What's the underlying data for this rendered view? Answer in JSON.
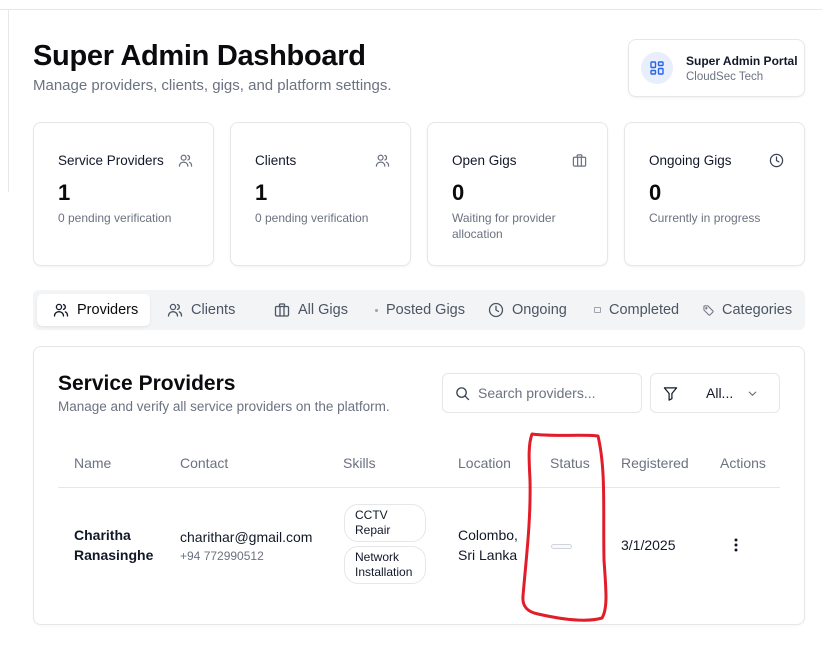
{
  "header": {
    "title": "Super Admin Dashboard",
    "subtitle": "Manage providers, clients, gigs, and platform settings."
  },
  "portal": {
    "title": "Super Admin Portal",
    "company": "CloudSec Tech",
    "icon": "layout-grid-icon"
  },
  "stats": [
    {
      "label": "Service Providers",
      "value": "1",
      "description": "0 pending verification",
      "icon": "users-icon"
    },
    {
      "label": "Clients",
      "value": "1",
      "description": "0 pending verification",
      "icon": "users-icon"
    },
    {
      "label": "Open Gigs",
      "value": "0",
      "description": "Waiting for provider allocation",
      "icon": "briefcase-icon"
    },
    {
      "label": "Ongoing Gigs",
      "value": "0",
      "description": "Currently in progress",
      "icon": "clock-icon"
    }
  ],
  "tabs": [
    {
      "label": "Providers",
      "icon": "users-icon",
      "active": true
    },
    {
      "label": "Clients",
      "icon": "users-icon",
      "active": false
    },
    {
      "label": "All Gigs",
      "icon": "briefcase-icon",
      "active": false
    },
    {
      "label": "Posted Gigs",
      "icon": "dot-icon",
      "active": false
    },
    {
      "label": "Ongoing",
      "icon": "clock-icon",
      "active": false
    },
    {
      "label": "Completed",
      "icon": "box-icon",
      "active": false
    },
    {
      "label": "Categories",
      "icon": "tag-icon",
      "active": false
    }
  ],
  "providers_panel": {
    "title": "Service Providers",
    "subtitle": "Manage and verify all service providers on the platform.",
    "search_placeholder": "Search providers...",
    "filter_value": "All...",
    "columns": [
      "Name",
      "Contact",
      "Skills",
      "Location",
      "Status",
      "Registered",
      "Actions"
    ],
    "rows": [
      {
        "name": "Charitha Ranasinghe",
        "email": "charithar@gmail.com",
        "phone": "+94 772990512",
        "skills": [
          "CCTV Repair",
          "Network Installation"
        ],
        "location": "Colombo, Sri Lanka",
        "status": "",
        "registered": "3/1/2025"
      }
    ]
  },
  "colors": {
    "accent": "#2563eb",
    "annotation": "#e11d2a",
    "muted_text": "#6b7280",
    "border": "#e5e7eb"
  }
}
